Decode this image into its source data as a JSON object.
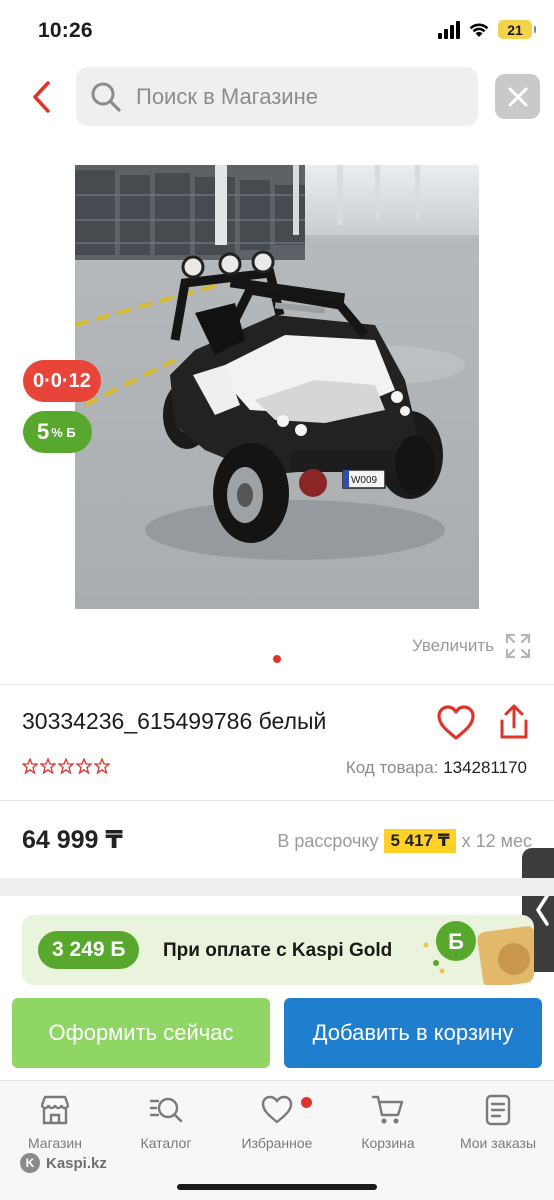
{
  "status_bar": {
    "time": "10:26",
    "battery": "21"
  },
  "search": {
    "placeholder": "Поиск в Магазине"
  },
  "product": {
    "badge_installment": "0·0·12",
    "badge_bonus_value": "5",
    "badge_bonus_suffix": "% Б",
    "image_plate_text": "W009",
    "zoom_label": "Увеличить",
    "title": "30334236_615499786 белый",
    "rating_stars": 0,
    "code_label": "Код товара:",
    "code_value": "134281170",
    "price": "64 999 ₸",
    "installment_prefix": "В рассрочку",
    "installment_amount": "5 417 ₸",
    "installment_suffix": "х 12 мес"
  },
  "kaspi_gold": {
    "bonus": "3 249 Б",
    "text": "При оплате с Kaspi Gold"
  },
  "actions": {
    "order_now": "Оформить сейчас",
    "add_to_cart": "Добавить в корзину"
  },
  "bottom_nav": {
    "items": [
      {
        "label": "Магазин",
        "icon": "store-icon"
      },
      {
        "label": "Каталог",
        "icon": "catalog-search-icon"
      },
      {
        "label": "Избранное",
        "icon": "heart-icon"
      },
      {
        "label": "Корзина",
        "icon": "cart-icon"
      },
      {
        "label": "Мои заказы",
        "icon": "orders-icon"
      }
    ]
  },
  "footer": {
    "brand": "Kaspi.kz"
  },
  "colors": {
    "accent_red": "#e0332b",
    "green": "#57a82c",
    "light_green": "#8fd664",
    "blue": "#1f7fce",
    "yellow": "#ffd128"
  }
}
